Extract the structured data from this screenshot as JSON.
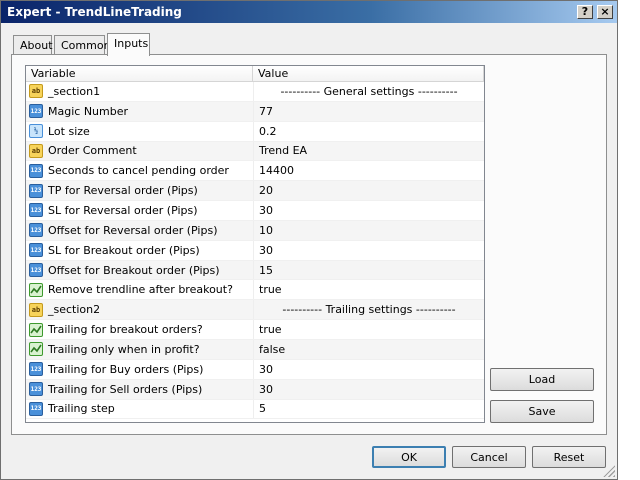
{
  "window": {
    "title": "Expert - TrendLineTrading",
    "help_label": "?",
    "close_label": "×"
  },
  "tabs": [
    {
      "label": "About",
      "active": false
    },
    {
      "label": "Common",
      "active": false
    },
    {
      "label": "Inputs",
      "active": true
    }
  ],
  "grid": {
    "columns": [
      "Variable",
      "Value"
    ],
    "rows": [
      {
        "icon": "ab",
        "name": "_section1",
        "value": "---------- General settings ----------",
        "center": true
      },
      {
        "icon": "123",
        "name": "Magic Number",
        "value": "77"
      },
      {
        "icon": "frac",
        "name": "Lot size",
        "value": "0.2"
      },
      {
        "icon": "ab",
        "name": "Order Comment",
        "value": "Trend EA"
      },
      {
        "icon": "123",
        "name": "Seconds to cancel pending order",
        "value": "14400"
      },
      {
        "icon": "123",
        "name": "TP for Reversal order (Pips)",
        "value": "20"
      },
      {
        "icon": "123",
        "name": "SL for Reversal order (Pips)",
        "value": "30"
      },
      {
        "icon": "123",
        "name": "Offset for Reversal order (Pips)",
        "value": "10"
      },
      {
        "icon": "123",
        "name": "SL for Breakout order (Pips)",
        "value": "30"
      },
      {
        "icon": "123",
        "name": "Offset for Breakout order (Pips)",
        "value": "15"
      },
      {
        "icon": "bool",
        "name": "Remove trendline after breakout?",
        "value": "true"
      },
      {
        "icon": "ab",
        "name": "_section2",
        "value": "---------- Trailing settings ----------",
        "center": true
      },
      {
        "icon": "bool",
        "name": "Trailing for breakout orders?",
        "value": "true"
      },
      {
        "icon": "bool",
        "name": "Trailing only when in profit?",
        "value": "false"
      },
      {
        "icon": "123",
        "name": "Trailing for Buy orders (Pips)",
        "value": "30"
      },
      {
        "icon": "123",
        "name": "Trailing for Sell orders (Pips)",
        "value": "30"
      },
      {
        "icon": "123",
        "name": "Trailing step",
        "value": "5"
      }
    ]
  },
  "side_buttons": {
    "load": "Load",
    "save": "Save"
  },
  "footer_buttons": {
    "ok": "OK",
    "cancel": "Cancel",
    "reset": "Reset"
  },
  "icon_labels": {
    "ab": "ab",
    "123": "123",
    "frac": "½"
  },
  "colors": {
    "title_start": "#0a246a",
    "title_end": "#a6caf0",
    "default_button_border": "#3c7fb1"
  }
}
